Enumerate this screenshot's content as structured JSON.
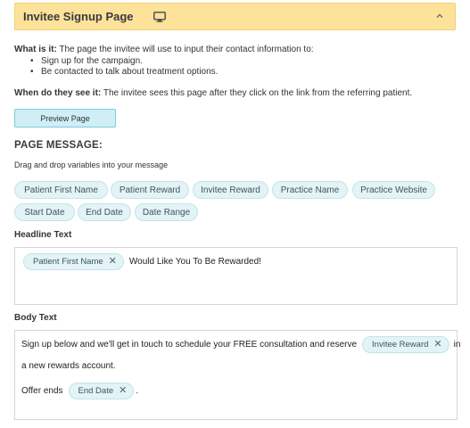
{
  "header": {
    "title": "Invitee Signup Page",
    "icon": "monitor-icon",
    "toggle_icon": "chevron-up-icon",
    "background_color": "#fde29a"
  },
  "info": {
    "what_label": "What is it:",
    "what_text": " The page the invitee will use to input their contact information to:",
    "bullets": [
      "Sign up for the campaign.",
      "Be contacted to talk about treatment options."
    ],
    "when_label": "When do they see it:",
    "when_text": " The invitee sees this page after they click on the link from the referring patient."
  },
  "preview_button": "Preview Page",
  "page_message": {
    "heading": "PAGE MESSAGE:",
    "hint": "Drag and drop variables into your message",
    "variables": [
      "Patient First Name",
      "Patient Reward",
      "Invitee Reward",
      "Practice Name",
      "Practice Website",
      "Start Date",
      "End Date",
      "Date Range"
    ]
  },
  "headline": {
    "label": "Headline Text",
    "tag": "Patient First Name",
    "text": "Would Like You To Be Rewarded!"
  },
  "body": {
    "label": "Body Text",
    "line1": "Sign up below and we'll get in touch to schedule your FREE consultation and reserve",
    "tag1": "Invitee Reward",
    "line1_end": "in",
    "line2": "a new rewards account.",
    "offer_prefix": "Offer ends",
    "tag2": "End Date",
    "offer_suffix": "."
  }
}
